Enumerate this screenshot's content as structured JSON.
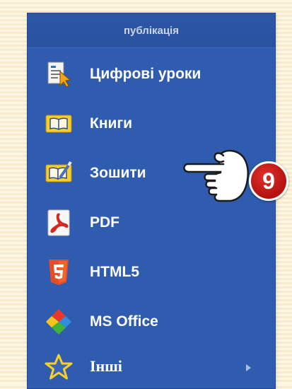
{
  "menu": {
    "header": "публікація",
    "items": [
      {
        "label": "Цифрові уроки",
        "icon": "digital-lesson-icon"
      },
      {
        "label": "Книги",
        "icon": "book-icon"
      },
      {
        "label": "Зошити",
        "icon": "workbook-icon"
      },
      {
        "label": "PDF",
        "icon": "pdf-icon"
      },
      {
        "label": "HTML5",
        "icon": "html5-icon"
      },
      {
        "label": "MS Office",
        "icon": "ms-office-icon"
      },
      {
        "label": "Інші",
        "icon": "star-icon",
        "has_submenu": true
      }
    ]
  },
  "callout": {
    "number": "9",
    "pointer": "pointing-hand-icon",
    "badge_color": "#c8201c"
  },
  "colors": {
    "panel": "#2f5cae",
    "item_text": "#ffffff",
    "header_text": "#c9d6ee"
  }
}
